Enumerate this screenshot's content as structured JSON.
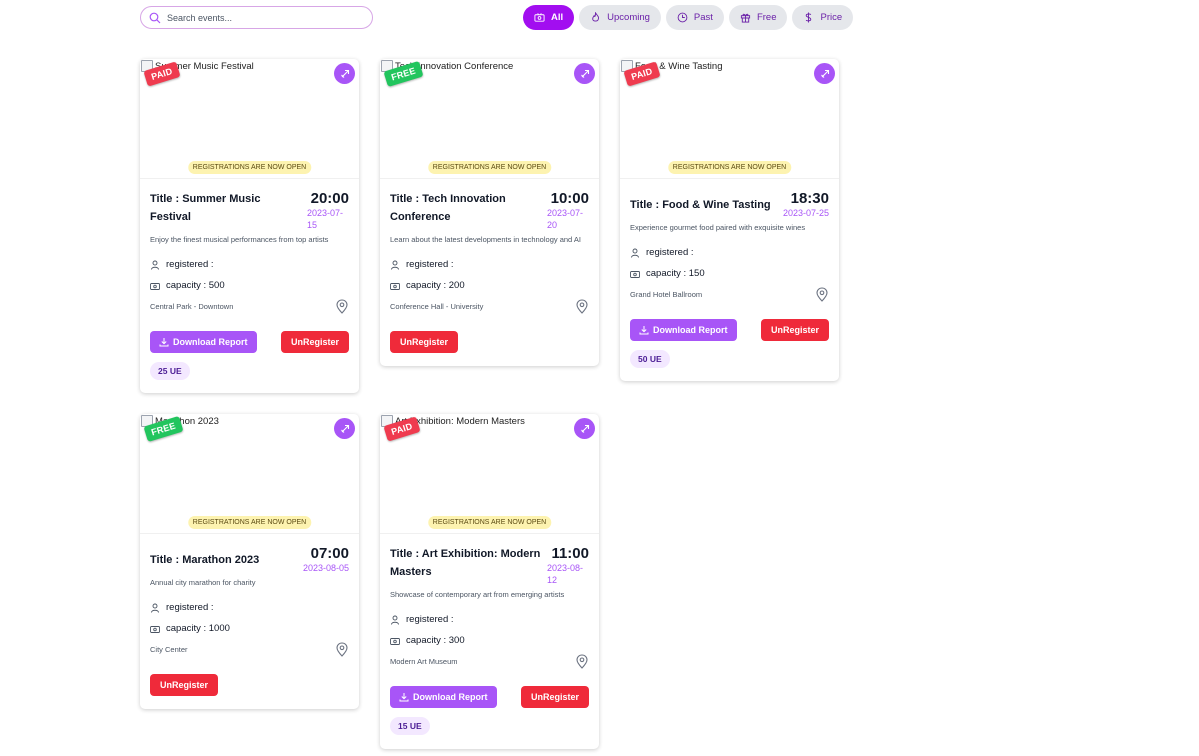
{
  "search": {
    "placeholder": "Search events..."
  },
  "filters": [
    {
      "label": "All",
      "icon": "ticket-icon",
      "active": true
    },
    {
      "label": "Upcoming",
      "icon": "flame-icon",
      "active": false
    },
    {
      "label": "Past",
      "icon": "clock-icon",
      "active": false
    },
    {
      "label": "Free",
      "icon": "gift-icon",
      "active": false
    },
    {
      "label": "Price",
      "icon": "dollar-icon",
      "active": false
    }
  ],
  "colors": {
    "accent": "#a20ef0",
    "purple": "#a855f7",
    "danger": "#ef2a3a",
    "free": "#22c55e",
    "paid": "#ef3b4f",
    "banner": "#fdf3b0"
  },
  "common": {
    "registration_banner": "REGISTRATIONS ARE NOW OPEN",
    "registered_label": "registered :",
    "download_label": "Download Report",
    "unregister_label": "UnRegister"
  },
  "events": [
    {
      "img_alt": "Summer Music Festival",
      "badge": "PAID",
      "title": "Title : Summer Music Festival",
      "time": "20:00",
      "date": "2023-07-15",
      "description": "Enjoy the finest musical performances from top artists",
      "capacity": "capacity : 500",
      "location": "Central Park - Downtown",
      "price": "25 UE"
    },
    {
      "img_alt": "Tech Innovation Conference",
      "badge": "FREE",
      "title": "Title : Tech Innovation Conference",
      "time": "10:00",
      "date": "2023-07-20",
      "description": "Learn about the latest developments in technology and AI",
      "capacity": "capacity : 200",
      "location": "Conference Hall - University",
      "price": ""
    },
    {
      "img_alt": "Food & Wine Tasting",
      "badge": "PAID",
      "title": "Title : Food & Wine Tasting",
      "time": "18:30",
      "date": "2023-07-25",
      "description": "Experience gourmet food paired with exquisite wines",
      "capacity": "capacity : 150",
      "location": "Grand Hotel Ballroom",
      "price": "50 UE"
    },
    {
      "img_alt": "Marathon 2023",
      "badge": "FREE",
      "title": "Title : Marathon 2023",
      "time": "07:00",
      "date": "2023-08-05",
      "description": "Annual city marathon for charity",
      "capacity": "capacity : 1000",
      "location": "City Center",
      "price": ""
    },
    {
      "img_alt": "Art Exhibition: Modern Masters",
      "badge": "PAID",
      "title": "Title : Art Exhibition: Modern Masters",
      "time": "11:00",
      "date": "2023-08-12",
      "description": "Showcase of contemporary art from emerging artists",
      "capacity": "capacity : 300",
      "location": "Modern Art Museum",
      "price": "15 UE"
    }
  ]
}
